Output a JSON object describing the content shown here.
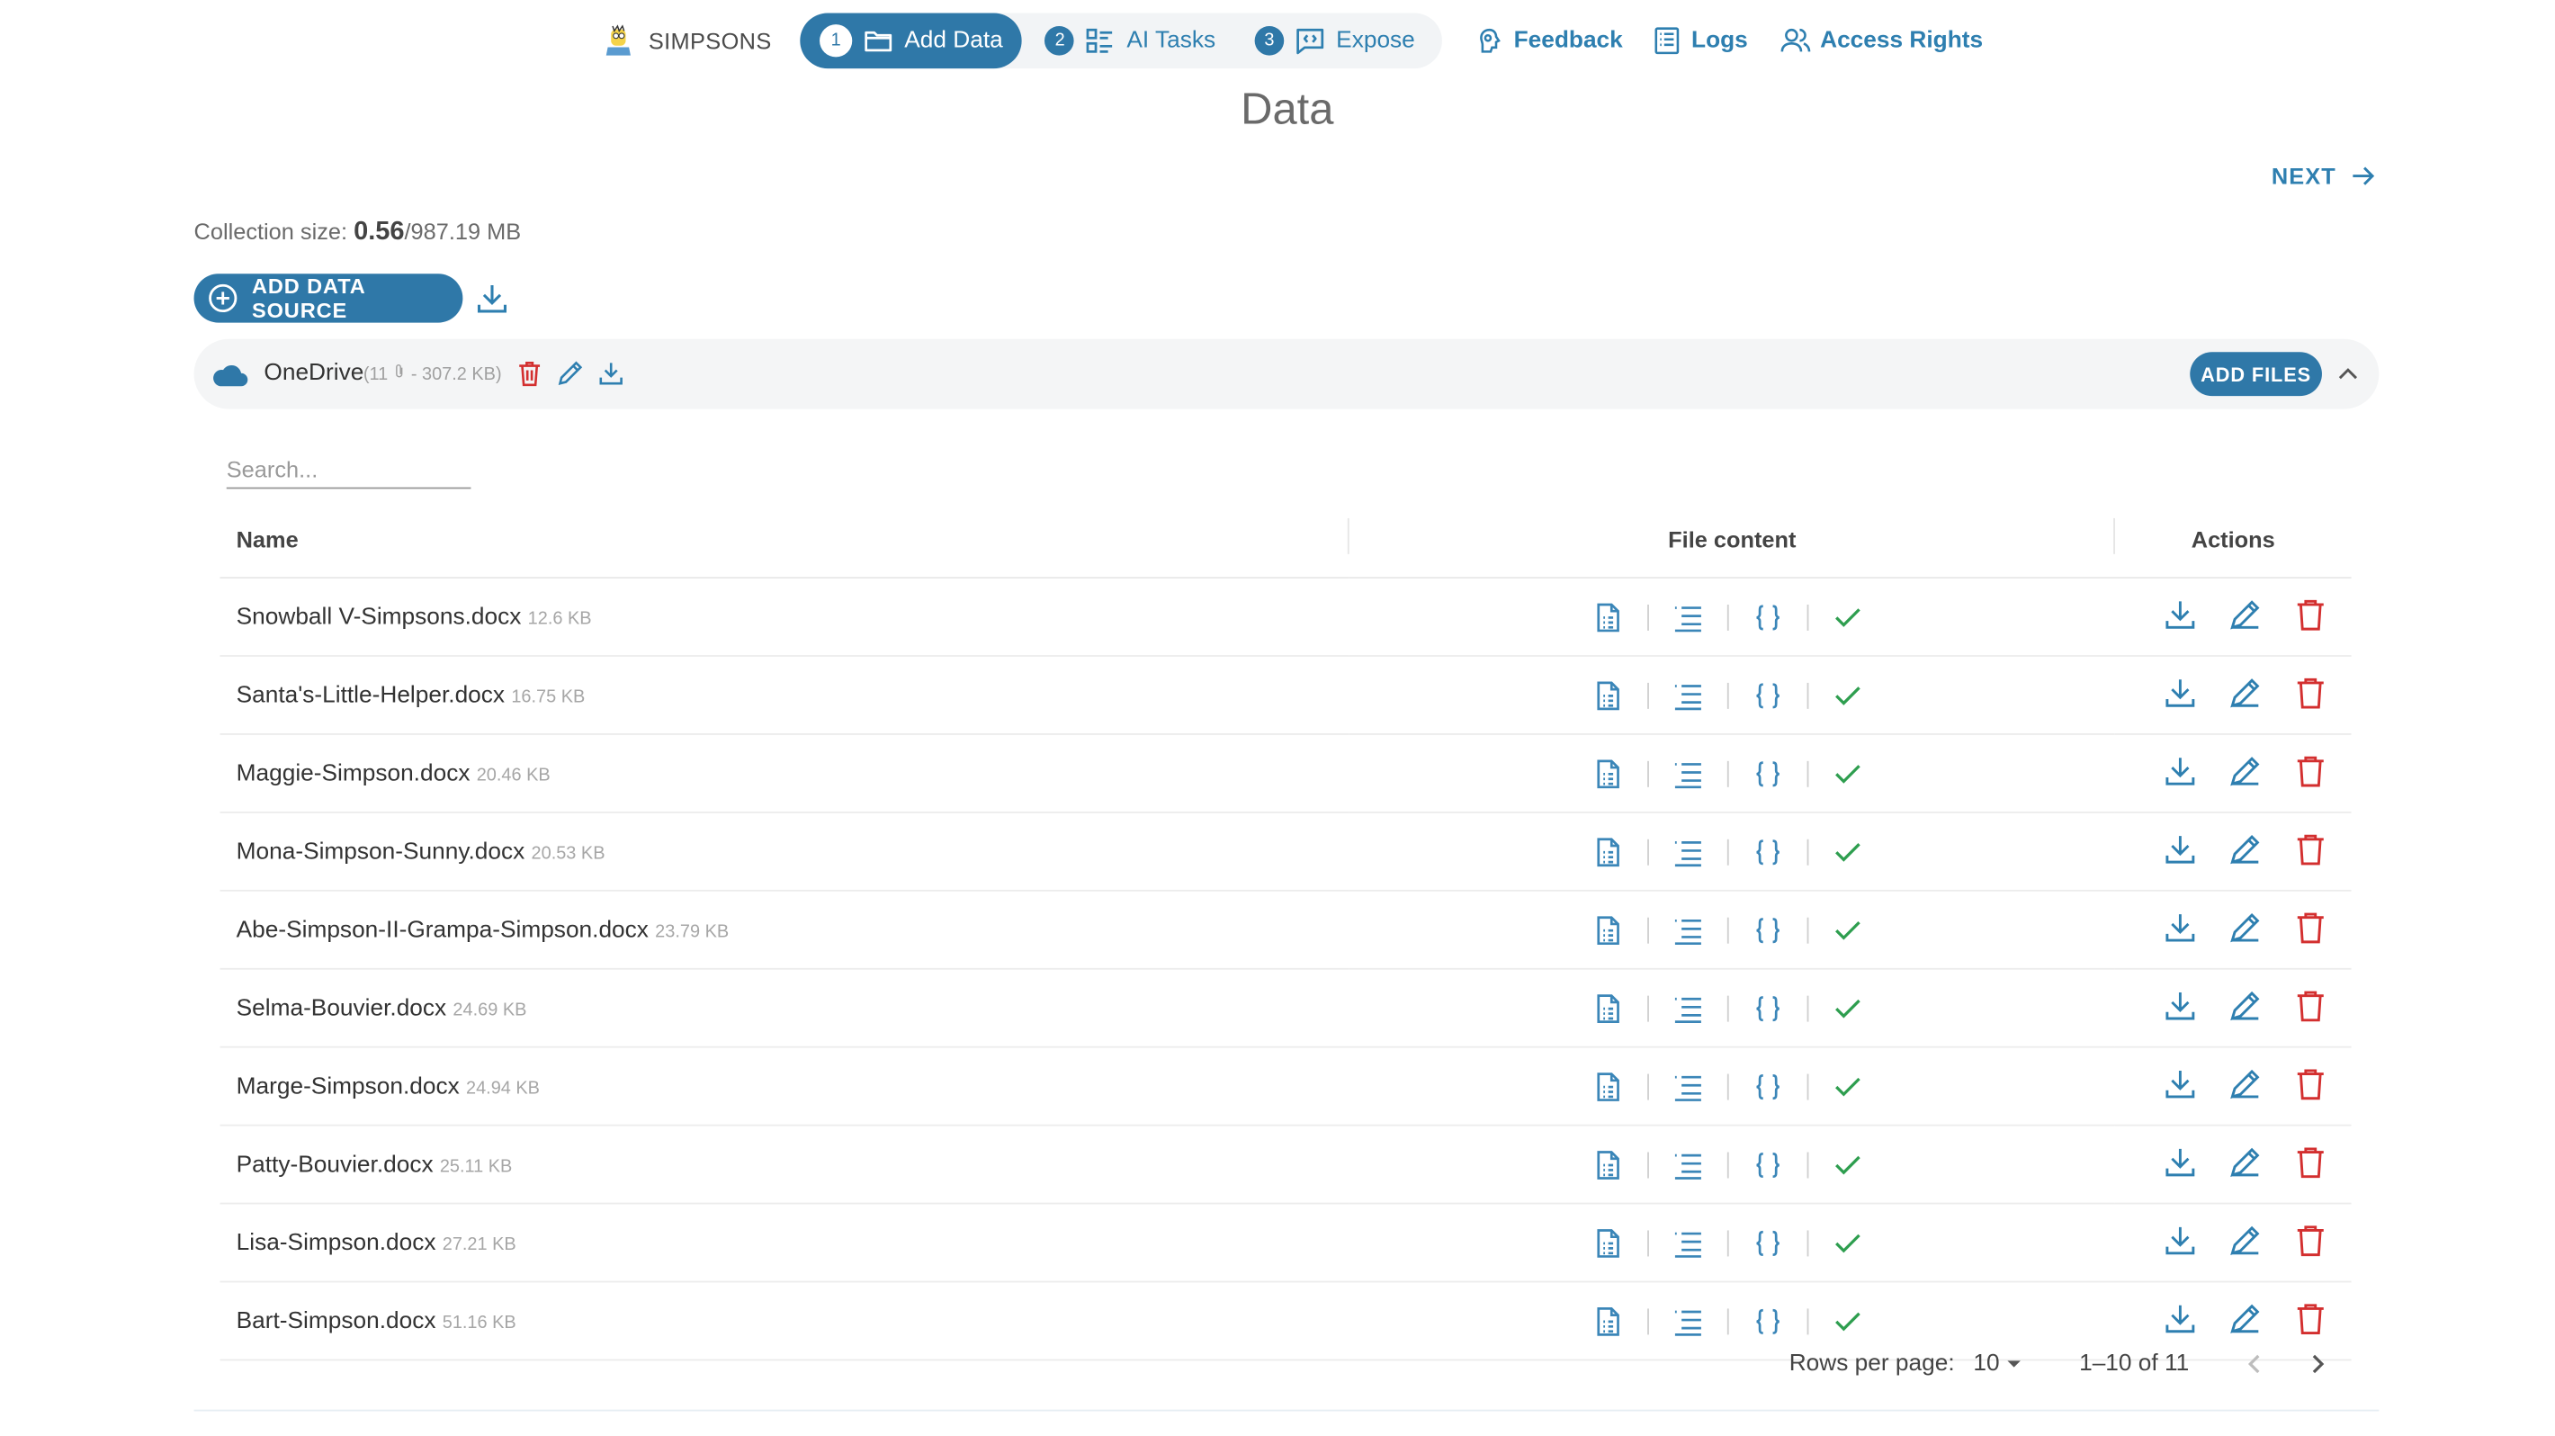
{
  "brand": {
    "name": "SIMPSONS"
  },
  "stepper": [
    {
      "num": "1",
      "label": "Add Data",
      "icon": "folder-icon",
      "active": true
    },
    {
      "num": "2",
      "label": "AI Tasks",
      "icon": "task-list-icon",
      "active": false
    },
    {
      "num": "3",
      "label": "Expose",
      "icon": "code-chat-icon",
      "active": false
    }
  ],
  "nav_links": [
    {
      "label": "Feedback",
      "icon": "brain-icon"
    },
    {
      "label": "Logs",
      "icon": "log-list-icon"
    },
    {
      "label": "Access Rights",
      "icon": "users-icon"
    }
  ],
  "page": {
    "title": "Data",
    "next_label": "NEXT"
  },
  "collection": {
    "label": "Collection size:",
    "used": "0.56",
    "total": "/987.19 MB"
  },
  "add_source_label": "ADD DATA SOURCE",
  "source": {
    "name": "OneDrive",
    "meta_open": "(11",
    "meta_close": "- 307.2 KB)",
    "add_files_label": "ADD FILES"
  },
  "search": {
    "placeholder": "Search..."
  },
  "table": {
    "headers": {
      "name": "Name",
      "content": "File content",
      "actions": "Actions"
    },
    "rows": [
      {
        "name": "Snowball V-Simpsons.docx",
        "size": "12.6 KB"
      },
      {
        "name": "Santa's-Little-Helper.docx",
        "size": "16.75 KB"
      },
      {
        "name": "Maggie-Simpson.docx",
        "size": "20.46 KB"
      },
      {
        "name": "Mona-Simpson-Sunny.docx",
        "size": "20.53 KB"
      },
      {
        "name": "Abe-Simpson-II-Grampa-Simpson.docx",
        "size": "23.79 KB"
      },
      {
        "name": "Selma-Bouvier.docx",
        "size": "24.69 KB"
      },
      {
        "name": "Marge-Simpson.docx",
        "size": "24.94 KB"
      },
      {
        "name": "Patty-Bouvier.docx",
        "size": "25.11 KB"
      },
      {
        "name": "Lisa-Simpson.docx",
        "size": "27.21 KB"
      },
      {
        "name": "Bart-Simpson.docx",
        "size": "51.16 KB"
      }
    ]
  },
  "pagination": {
    "rows_per_page_label": "Rows per page:",
    "rows_per_page": "10",
    "range": "1–10 of 11"
  },
  "colors": {
    "accent": "#2f78a8",
    "link": "#2e7fb0",
    "danger": "#d32f2f",
    "success": "#2e9e4f",
    "file_icon": "#3b86b8"
  }
}
